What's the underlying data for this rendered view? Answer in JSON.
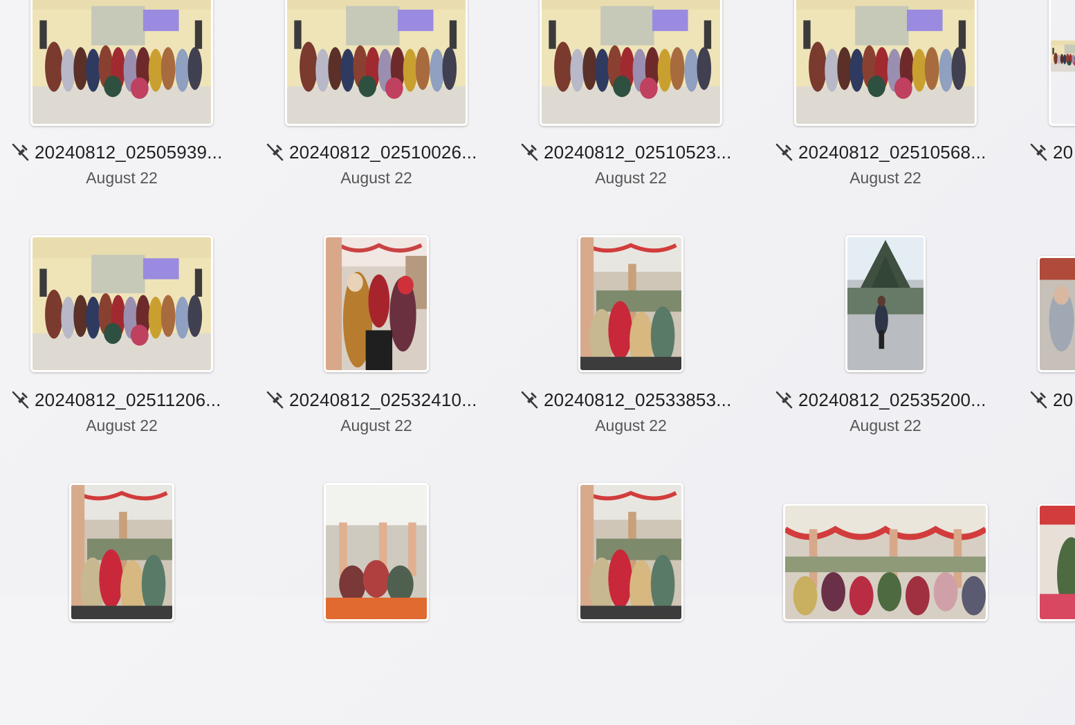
{
  "gallery": {
    "rows": [
      [
        {
          "name": "20240812_02505939...",
          "date": "August 22",
          "icon": "sync-off-icon",
          "photo": "group-photo"
        },
        {
          "name": "20240812_02510026...",
          "date": "August 22",
          "icon": "sync-off-icon",
          "photo": "group-photo"
        },
        {
          "name": "20240812_02510523...",
          "date": "August 22",
          "icon": "sync-off-icon",
          "photo": "group-photo"
        },
        {
          "name": "20240812_02510568...",
          "date": "August 22",
          "icon": "sync-off-icon",
          "photo": "group-photo"
        },
        {
          "name": "20",
          "date": "",
          "icon": "sync-off-icon",
          "photo": "group-photo"
        }
      ],
      [
        {
          "name": "20240812_02511206...",
          "date": "August 22",
          "icon": "sync-off-icon",
          "photo": "group-photo"
        },
        {
          "name": "20240812_02532410...",
          "date": "August 22",
          "icon": "sync-off-icon",
          "photo": "portrait-crowd"
        },
        {
          "name": "20240812_02533853...",
          "date": "August 22",
          "icon": "sync-off-icon",
          "photo": "portrait-hall"
        },
        {
          "name": "20240812_02535200...",
          "date": "August 22",
          "icon": "sync-off-icon",
          "photo": "portrait-outdoor"
        },
        {
          "name": "20",
          "date": "",
          "icon": "sync-off-icon",
          "photo": "portrait-partial"
        }
      ],
      [
        {
          "name": "",
          "date": "",
          "icon": "",
          "photo": "portrait-hall"
        },
        {
          "name": "",
          "date": "",
          "icon": "",
          "photo": "portrait-hall"
        },
        {
          "name": "",
          "date": "",
          "icon": "",
          "photo": "portrait-hall"
        },
        {
          "name": "",
          "date": "",
          "icon": "",
          "photo": "landscape-hall"
        },
        {
          "name": "",
          "date": "",
          "icon": "",
          "photo": "portrait-partial"
        }
      ]
    ]
  },
  "colors": {
    "background": "#f1f1f4",
    "text_primary": "#1f1f1f",
    "text_secondary": "#555555",
    "thumb_border": "#ffffff"
  }
}
